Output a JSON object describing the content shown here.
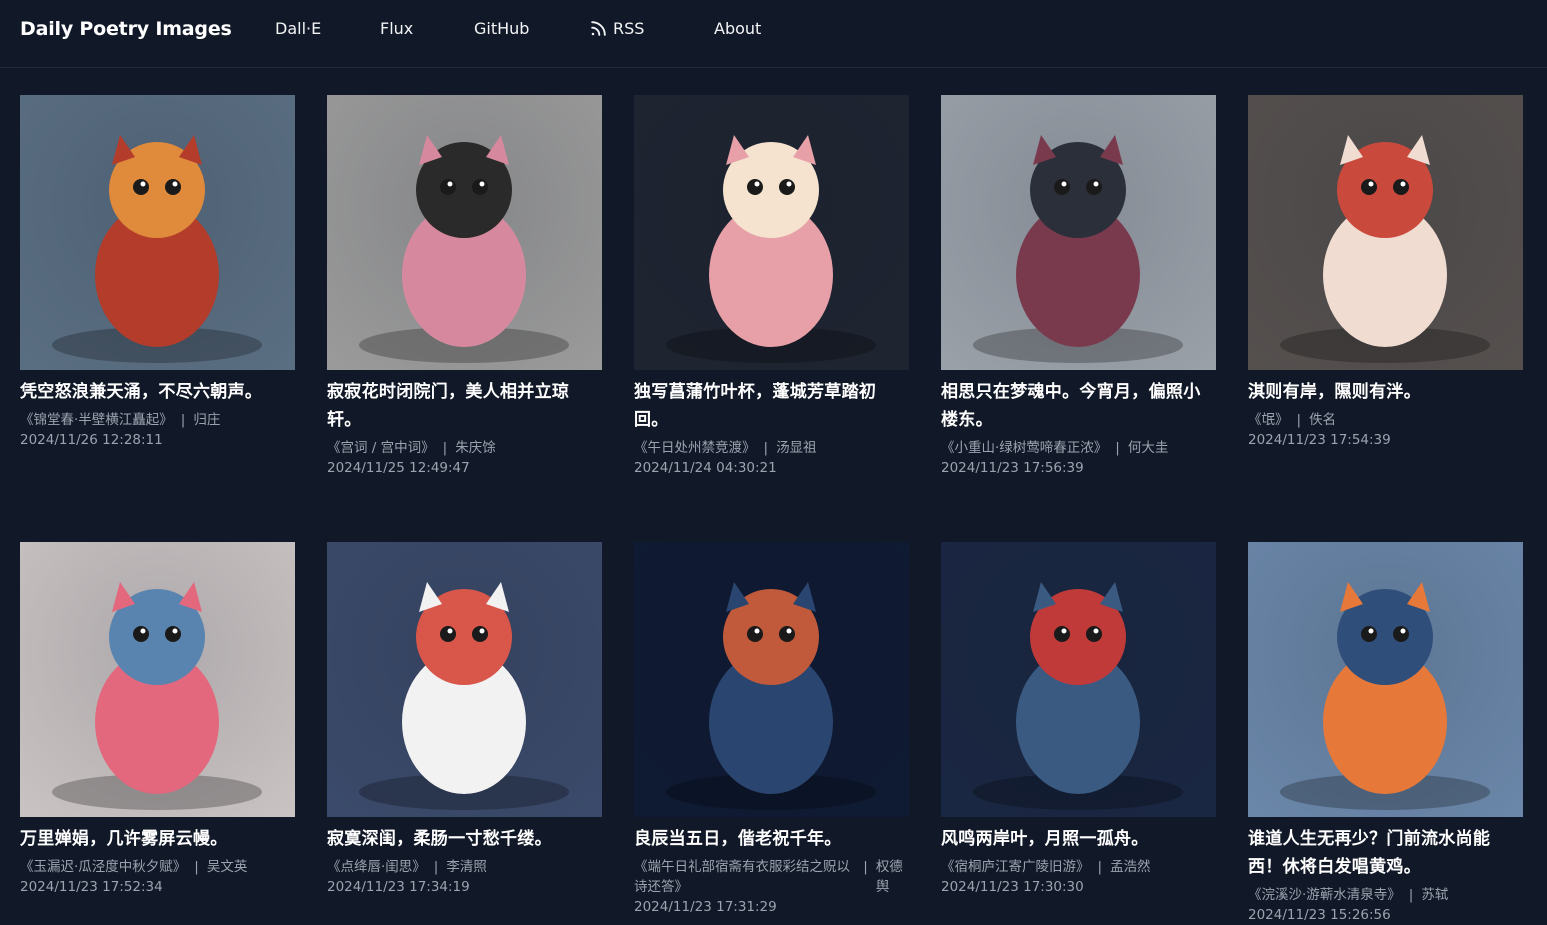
{
  "header": {
    "brand": "Daily Poetry Images",
    "nav": [
      {
        "label": "Dall·E"
      },
      {
        "label": "Flux"
      },
      {
        "label": "GitHub"
      },
      {
        "label": "RSS",
        "icon": "rss-icon"
      },
      {
        "label": "About"
      }
    ]
  },
  "cards": [
    {
      "poem": "凭空怒浪兼天涌，不尽六朝声。",
      "source": "《锦堂春·半壁横江矗起》",
      "author": "归庄",
      "date": "2024/11/26 12:28:11",
      "palette": [
        "#5a6e82",
        "#b33c2a",
        "#e08a3c"
      ]
    },
    {
      "poem": "寂寂花时闭院门，美人相并立琼轩。",
      "source": "《宫词 / 宫中词》",
      "author": "朱庆馀",
      "date": "2024/11/25 12:49:47",
      "palette": [
        "#9a9a9a",
        "#d6899e",
        "#2a2a2a"
      ]
    },
    {
      "poem": "独写菖蒲竹叶杯，蓬城芳草踏初回。",
      "source": "《午日处州禁竞渡》",
      "author": "汤显祖",
      "date": "2024/11/24 04:30:21",
      "palette": [
        "#1e2430",
        "#e7a0a7",
        "#f5e3d0"
      ]
    },
    {
      "poem": "相思只在梦魂中。今宵月，偏照小楼东。",
      "source": "《小重山·绿树莺啼春正浓》",
      "author": "何大圭",
      "date": "2024/11/23 17:56:39",
      "palette": [
        "#9aa0a8",
        "#7a3a4e",
        "#2a2f3a"
      ]
    },
    {
      "poem": "淇则有岸，隰则有泮。",
      "source": "《氓》",
      "author": "佚名",
      "date": "2024/11/23 17:54:39",
      "palette": [
        "#55504e",
        "#f1dcd2",
        "#c94a3c"
      ]
    },
    {
      "poem": "万里婵娟，几许雾屏云幔。",
      "source": "《玉漏迟·瓜泾度中秋夕赋》",
      "author": "吴文英",
      "date": "2024/11/23 17:52:34",
      "palette": [
        "#c9c2c2",
        "#e3687e",
        "#5a84b0"
      ]
    },
    {
      "poem": "寂寞深闺，柔肠一寸愁千缕。",
      "source": "《点绛唇·闺思》",
      "author": "李清照",
      "date": "2024/11/23 17:34:19",
      "palette": [
        "#3b4a6a",
        "#f2f2f2",
        "#d8574a"
      ]
    },
    {
      "poem": "良辰当五日，偕老祝千年。",
      "source": "《端午日礼部宿斋有衣服彩结之贶以诗还答》",
      "author": "权德舆",
      "date": "2024/11/23 17:31:29",
      "palette": [
        "#0f1a33",
        "#2a4670",
        "#c05a3a"
      ]
    },
    {
      "poem": "风鸣两岸叶，月照一孤舟。",
      "source": "《宿桐庐江寄广陵旧游》",
      "author": "孟浩然",
      "date": "2024/11/23 17:30:30",
      "palette": [
        "#1a2742",
        "#3a5a82",
        "#c03a3a"
      ]
    },
    {
      "poem": "谁道人生无再少？门前流水尚能西！休将白发唱黄鸡。",
      "source": "《浣溪沙·游蕲水清泉寺》",
      "author": "苏轼",
      "date": "2024/11/23 15:26:56",
      "palette": [
        "#6a86a8",
        "#e6793a",
        "#2f4e7a"
      ]
    }
  ]
}
